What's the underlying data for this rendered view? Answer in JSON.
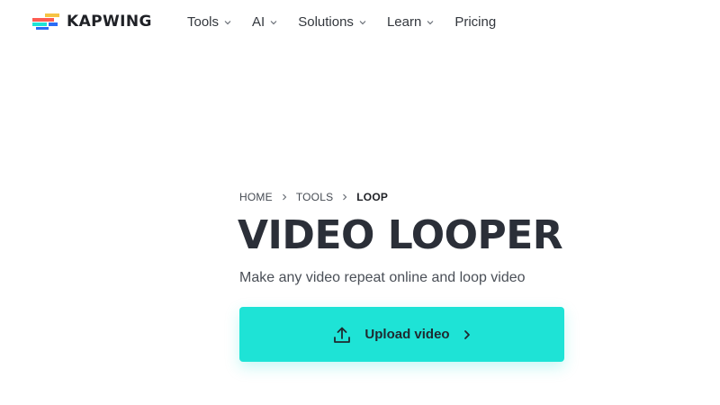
{
  "brand": {
    "name": "KAPWING",
    "logo_colors": [
      "#f6c343",
      "#fe5b52",
      "#1ee3d6",
      "#2b6cf6"
    ]
  },
  "nav": {
    "items": [
      {
        "label": "Tools",
        "has_dropdown": true
      },
      {
        "label": "AI",
        "has_dropdown": true
      },
      {
        "label": "Solutions",
        "has_dropdown": true
      },
      {
        "label": "Learn",
        "has_dropdown": true
      },
      {
        "label": "Pricing",
        "has_dropdown": false
      }
    ]
  },
  "breadcrumb": {
    "items": [
      {
        "label": "HOME"
      },
      {
        "label": "TOOLS"
      },
      {
        "label": "LOOP"
      }
    ]
  },
  "hero": {
    "title": "VIDEO LOOPER",
    "subtitle": "Make any video repeat online and loop video",
    "upload_label": "Upload video",
    "upload_icon": "upload-icon",
    "button_color": "#1ee3d6"
  }
}
